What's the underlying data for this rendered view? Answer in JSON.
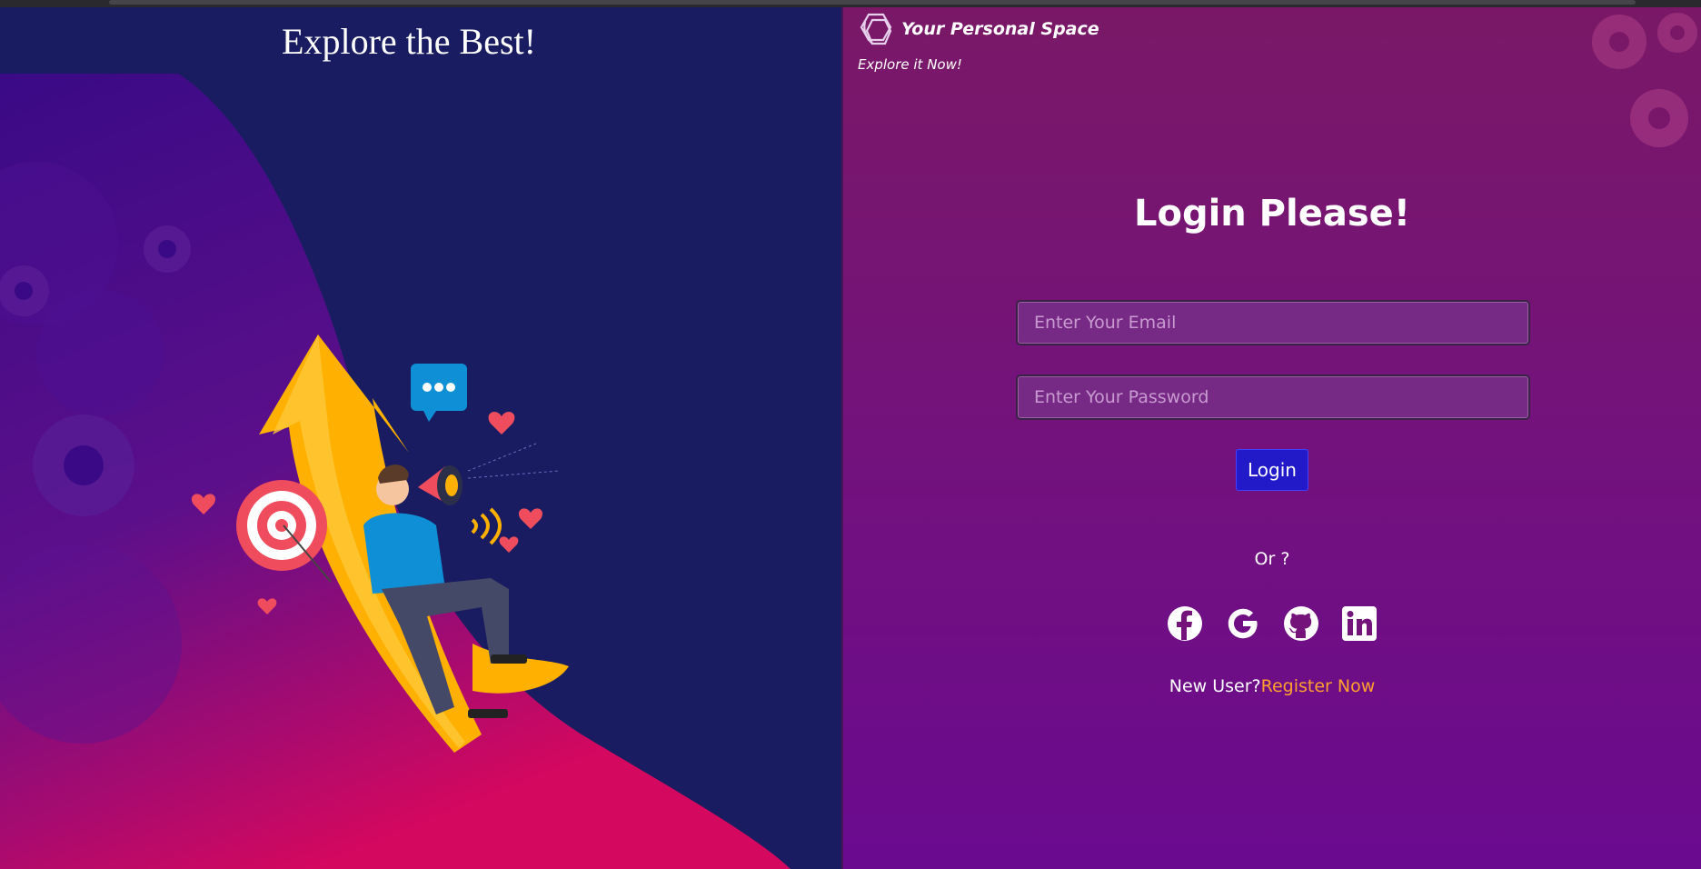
{
  "left": {
    "headline": "Explore the Best!"
  },
  "brand": {
    "name": "Your Personal Space",
    "tagline": "Explore it Now!"
  },
  "login": {
    "title": "Login Please!",
    "email_placeholder": "Enter Your Email",
    "password_placeholder": "Enter Your Password",
    "button_label": "Login",
    "or_text": "Or ?",
    "new_user_text": "New User?",
    "register_link": "Register Now"
  },
  "socials": [
    "facebook-icon",
    "google-icon",
    "github-icon",
    "linkedin-icon"
  ],
  "colors": {
    "left_bg": "#1a1c61",
    "right_bg_top": "#7a1867",
    "right_bg_bottom": "#6a0a8f",
    "login_button": "#2219c9",
    "register_link": "#ff9f2e",
    "arrow": "#ffb000",
    "shirt": "#0f8fd6"
  }
}
